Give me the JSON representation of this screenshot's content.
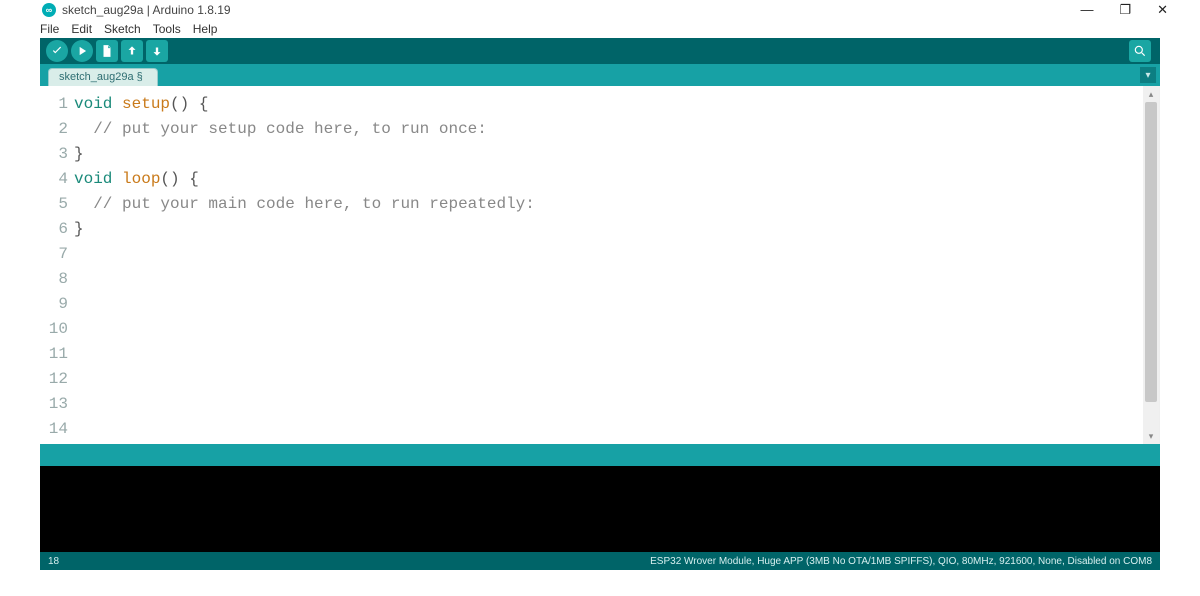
{
  "window": {
    "title": "sketch_aug29a | Arduino 1.8.19"
  },
  "menu": {
    "file": "File",
    "edit": "Edit",
    "sketch": "Sketch",
    "tools": "Tools",
    "help": "Help"
  },
  "tabs": {
    "active": "sketch_aug29a §"
  },
  "code": {
    "lines": [
      {
        "t": "void",
        "c": "kw"
      },
      {
        "t": "setup",
        "c": "fn"
      }
    ],
    "l1_void": "void",
    "l1_setup": "setup",
    "l1_rest": "() {",
    "l2": "  // put your setup code here, to run once:",
    "l3": "",
    "l4": "}",
    "l5": "",
    "l6_void": "void",
    "l6_loop": "loop",
    "l6_rest": "() {",
    "l7": "  // put your main code here, to run repeatedly:",
    "l8": "",
    "l9": "}"
  },
  "gutter": {
    "n1": "1",
    "n2": "2",
    "n3": "3",
    "n4": "4",
    "n5": "5",
    "n6": "6",
    "n7": "7",
    "n8": "8",
    "n9": "9",
    "n10": "10",
    "n11": "11",
    "n12": "12",
    "n13": "13",
    "n14": "14"
  },
  "status": {
    "left": "18",
    "right": "ESP32 Wrover Module, Huge APP (3MB No OTA/1MB SPIFFS), QIO, 80MHz, 921600, None, Disabled on COM8"
  }
}
